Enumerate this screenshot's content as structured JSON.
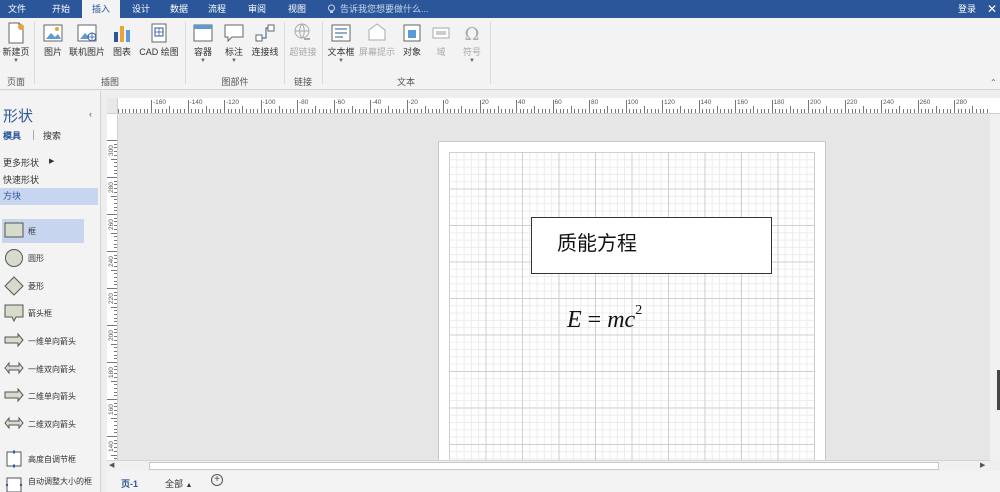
{
  "tabs": [
    "文件",
    "开始",
    "插入",
    "设计",
    "数据",
    "流程",
    "审阅",
    "视图"
  ],
  "active_tab": "插入",
  "tell_me_placeholder": "告诉我您想要做什么...",
  "login_label": "登录",
  "ribbon": {
    "groups": {
      "page": "页面",
      "illustrations": "插图",
      "diagram_parts": "图部件",
      "links": "链接",
      "text": "文本"
    },
    "buttons": {
      "new_page": "新建页",
      "picture": "图片",
      "online_picture": "联机图片",
      "chart": "图表",
      "cad_drawing": "CAD 绘图",
      "container": "容器",
      "callout": "标注",
      "connector": "连接线",
      "hyperlink": "超链接",
      "text_box": "文本框",
      "screen_tip": "屏幕提示",
      "object": "对象",
      "field": "域",
      "symbol": "符号"
    }
  },
  "shapes_panel": {
    "title": "形状",
    "tab_stencils": "模具",
    "tab_search": "搜索",
    "more_shapes": "更多形状",
    "quick_shapes": "快速形状",
    "stencil_name": "方块",
    "items": [
      {
        "label": "框",
        "icon": "box-shape-icon"
      },
      {
        "label": "圆形",
        "icon": "circle-shape-icon"
      },
      {
        "label": "菱形",
        "icon": "diamond-shape-icon"
      },
      {
        "label": "箭头框",
        "icon": "arrow-box-shape-icon"
      },
      {
        "label": "一维单向箭头",
        "icon": "1d-single-arrow-icon"
      },
      {
        "label": "一维双向箭头",
        "icon": "1d-double-arrow-icon"
      },
      {
        "label": "二维单向箭头",
        "icon": "2d-single-arrow-icon"
      },
      {
        "label": "二维双向箭头",
        "icon": "2d-double-arrow-icon"
      },
      {
        "label": "高度自调节框",
        "icon": "auto-height-box-icon"
      },
      {
        "label": "自动调整大小的框",
        "icon": "auto-size-box-icon"
      }
    ]
  },
  "ruler": {
    "top_labels": [
      "-160",
      "-140",
      "-120",
      "-100",
      "-80",
      "-60",
      "-40",
      "-20",
      "0",
      "20",
      "40",
      "60",
      "80",
      "100",
      "120",
      "140",
      "160",
      "180",
      "200",
      "220",
      "240",
      "260",
      "280"
    ],
    "left_labels": [
      "300",
      "280",
      "260",
      "240",
      "220",
      "200",
      "180",
      "160",
      "140"
    ]
  },
  "canvas": {
    "title_text": "质能方程",
    "equation": {
      "lhs": "E",
      "op": "=",
      "rhs": "mc",
      "exp": "2"
    }
  },
  "page_tabs": {
    "current": "页-1",
    "all": "全部"
  },
  "colors": {
    "accent": "#2b579a",
    "selection": "#c7d5ef"
  }
}
